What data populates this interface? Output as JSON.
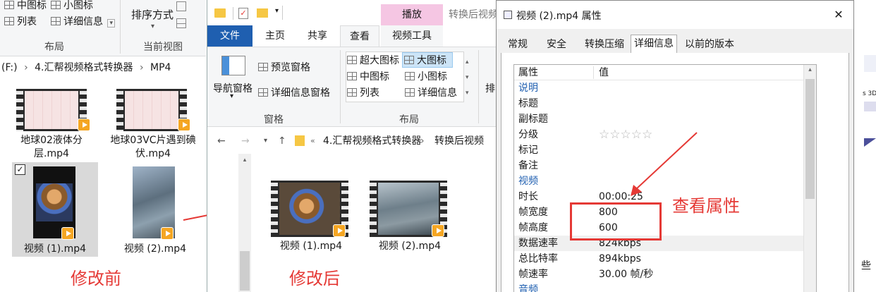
{
  "left": {
    "ribbon": {
      "item_detail": "中图标",
      "item_small": "小图标",
      "item_list": "列表",
      "item_details": "详细信息",
      "sort_by": "排序方式",
      "group_layout": "布局",
      "group_current_view": "当前视图"
    },
    "address": [
      "(F:)",
      "4.汇帮视频格式转换器",
      "MP4"
    ],
    "files": [
      {
        "name": "地球02液体分层.mp4"
      },
      {
        "name": "地球03VC片遇到碘伏.mp4"
      },
      {
        "name": "视频 (1).mp4"
      },
      {
        "name": "视频 (2).mp4"
      }
    ],
    "note_before": "修改前"
  },
  "middle": {
    "title_partial": "转换后视频",
    "tabs": {
      "file": "文件",
      "home": "主页",
      "share": "共享",
      "view": "查看",
      "video_tools": "视频工具",
      "play": "播放"
    },
    "ribbon": {
      "nav_pane": "导航窗格",
      "preview_pane": "预览窗格",
      "details_pane": "详细信息窗格",
      "group_panes": "窗格",
      "extra_large": "超大图标",
      "large": "大图标",
      "medium": "中图标",
      "small": "小图标",
      "list": "列表",
      "details": "详细信息",
      "group_layout": "布局",
      "sort_partial": "排"
    },
    "address": [
      "«",
      "4.汇帮视频格式转换器",
      "转换后视频"
    ],
    "files": [
      {
        "name": "视频 (1).mp4"
      },
      {
        "name": "视频 (2).mp4"
      }
    ],
    "note_after": "修改后"
  },
  "props": {
    "title": "视频 (2).mp4 属性",
    "close": "✕",
    "tabs": [
      "常规",
      "安全",
      "转换压缩",
      "详细信息",
      "以前的版本"
    ],
    "active_tab": "详细信息",
    "col_prop": "属性",
    "col_value": "值",
    "rows": [
      {
        "k": "说明",
        "v": "",
        "section": true
      },
      {
        "k": "标题",
        "v": ""
      },
      {
        "k": "副标题",
        "v": ""
      },
      {
        "k": "分级",
        "v": "☆☆☆☆☆"
      },
      {
        "k": "标记",
        "v": ""
      },
      {
        "k": "备注",
        "v": ""
      },
      {
        "k": "视频",
        "v": "",
        "section": true
      },
      {
        "k": "时长",
        "v": "00:00:25"
      },
      {
        "k": "帧宽度",
        "v": "800"
      },
      {
        "k": "帧高度",
        "v": "600"
      },
      {
        "k": "数据速率",
        "v": "824kbps"
      },
      {
        "k": "总比特率",
        "v": "894kbps"
      },
      {
        "k": "帧速率",
        "v": "30.00 帧/秒"
      },
      {
        "k": "音频",
        "v": "",
        "section": true
      }
    ],
    "note_view": "查看属性"
  },
  "right_strip": {
    "text_3d": "s 3D",
    "text_bottom": "些"
  },
  "colors": {
    "accent": "#1f5fb0",
    "annotation": "#e53935",
    "play_tab": "#f5c6e3"
  }
}
